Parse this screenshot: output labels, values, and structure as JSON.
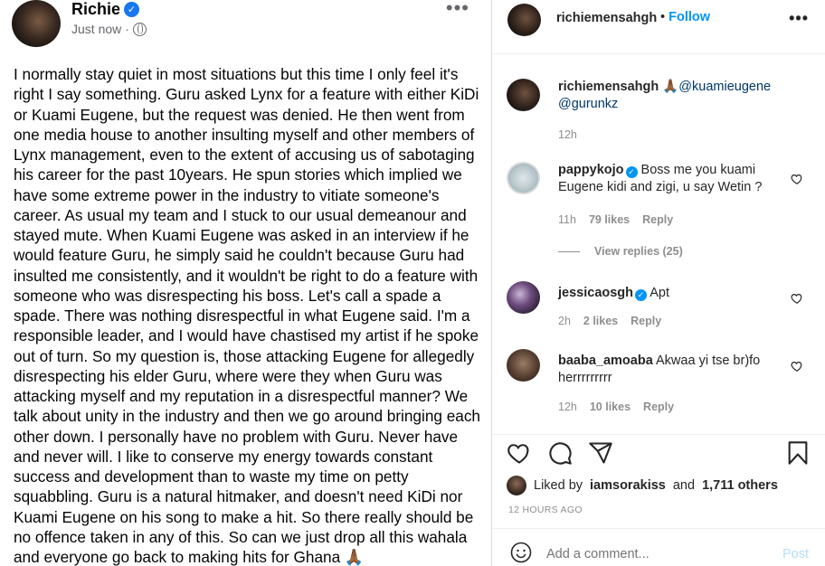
{
  "fb_post": {
    "author": "Richie",
    "time": "Just now",
    "separator": "·",
    "more": "•••",
    "text": "I normally stay quiet in most situations but this time I only feel it's right I say something. Guru asked Lynx for a feature with either KiDi or Kuami Eugene, but the request was denied. He then went from one media house to another insulting myself and other members of Lynx management, even to the extent of accusing us of sabotaging his career for the past 10years. He spun stories which implied we have some extreme power in the industry to vitiate someone's career. As usual my team and I stuck to our usual demeanour and stayed mute. When Kuami Eugene was asked in an interview if he would feature Guru, he simply said he couldn't because Guru had insulted me consistently, and it wouldn't be right to do a feature with someone who was disrespecting his boss. Let's call a spade a spade. There was nothing disrespectful in what Eugene said. I'm a responsible leader, and I would have chastised my artist if he spoke out of turn. So my question is, those attacking Eugene for allegedly disrespecting his elder Guru, where were they when Guru was attacking myself and my reputation in a disrespectful manner? We talk about unity in the industry and then we go around bringing each other down. I personally have no problem with Guru. Never have and never will. I like to conserve my energy towards constant success and development than to waste my time on petty squabbling. Guru is a natural hitmaker, and doesn't need KiDi nor Kuami Eugene on his song to make a hit. So there really should be no offence taken in any of this. So can we just drop all this wahala and everyone go back to making hits for Ghana 🙏🏾"
  },
  "header": {
    "username": "richiemensahgh",
    "dot": "•",
    "follow": "Follow",
    "more": "•••"
  },
  "caption": {
    "username": "richiemensahgh",
    "emoji": "🙏🏾",
    "mention1": "@kuamieugene",
    "mention2": "@gurunkz",
    "time": "12h"
  },
  "comments": [
    {
      "username": "pappykojo",
      "verified": true,
      "text": "Boss me you kuami Eugene kidi and zigi, u say Wetin ?",
      "time": "11h",
      "likes": "79 likes",
      "reply": "Reply"
    },
    {
      "username": "jessicaosgh",
      "verified": true,
      "text": "Apt",
      "time": "2h",
      "likes": "2 likes",
      "reply": "Reply"
    },
    {
      "username": "baaba_amoaba",
      "verified": false,
      "text": "Akwaa yi tse br)fo herrrrrrrrr",
      "time": "12h",
      "likes": "10 likes",
      "reply": "Reply"
    }
  ],
  "view_replies": "View replies (25)",
  "actions": {
    "liked_prefix": "Liked by",
    "liked_user": "iamsorakiss",
    "liked_and": "and",
    "liked_count": "1,711 others",
    "time_ago": "12 HOURS AGO",
    "add_comment_placeholder": "Add a comment...",
    "post": "Post"
  },
  "icons": [
    "heart-icon",
    "comment-icon",
    "share-icon",
    "bookmark-icon",
    "emoji-icon",
    "globe-icon",
    "verified-icon"
  ]
}
